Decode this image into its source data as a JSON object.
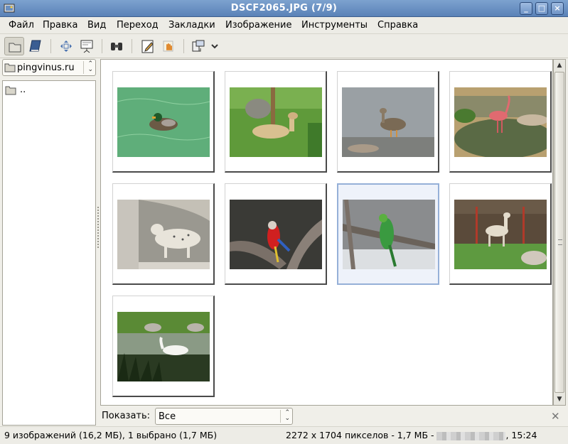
{
  "window": {
    "title": "DSCF2065.JPG  (7/9)",
    "buttons": {
      "minimize": "_",
      "maximize": "□",
      "close": "×"
    }
  },
  "menu": [
    {
      "label": "Файл"
    },
    {
      "label": "Правка"
    },
    {
      "label": "Вид"
    },
    {
      "label": "Переход"
    },
    {
      "label": "Закладки"
    },
    {
      "label": "Изображение"
    },
    {
      "label": "Инструменты"
    },
    {
      "label": "Справка"
    }
  ],
  "toolbar": {
    "icons": [
      "folder-view-icon",
      "book-icon",
      "move-icon",
      "slideshow-icon",
      "binoculars-icon",
      "edit-icon",
      "hand-icon",
      "transform-icon",
      "chevron-down-icon"
    ]
  },
  "sidebar": {
    "location": "pingvinus.ru",
    "folders": [
      {
        "name": ".."
      }
    ]
  },
  "thumbnails": [
    {
      "subject": "duck",
      "selected": false
    },
    {
      "subject": "alpaca-lying",
      "selected": false
    },
    {
      "subject": "goose",
      "selected": false
    },
    {
      "subject": "flamingo",
      "selected": false
    },
    {
      "subject": "snow-leopard",
      "selected": false
    },
    {
      "subject": "red-macaw",
      "selected": false
    },
    {
      "subject": "green-parrot",
      "selected": true
    },
    {
      "subject": "llama",
      "selected": false
    },
    {
      "subject": "white-goose",
      "selected": false
    }
  ],
  "filter": {
    "label": "Показать:",
    "value": "Все"
  },
  "status": {
    "left": "9 изображений (16,2 МБ), 1 выбрано (1,7 МБ)",
    "right_prefix": "2272 x 1704 пикселов - 1,7 МБ - ",
    "time": ", 15:24"
  }
}
